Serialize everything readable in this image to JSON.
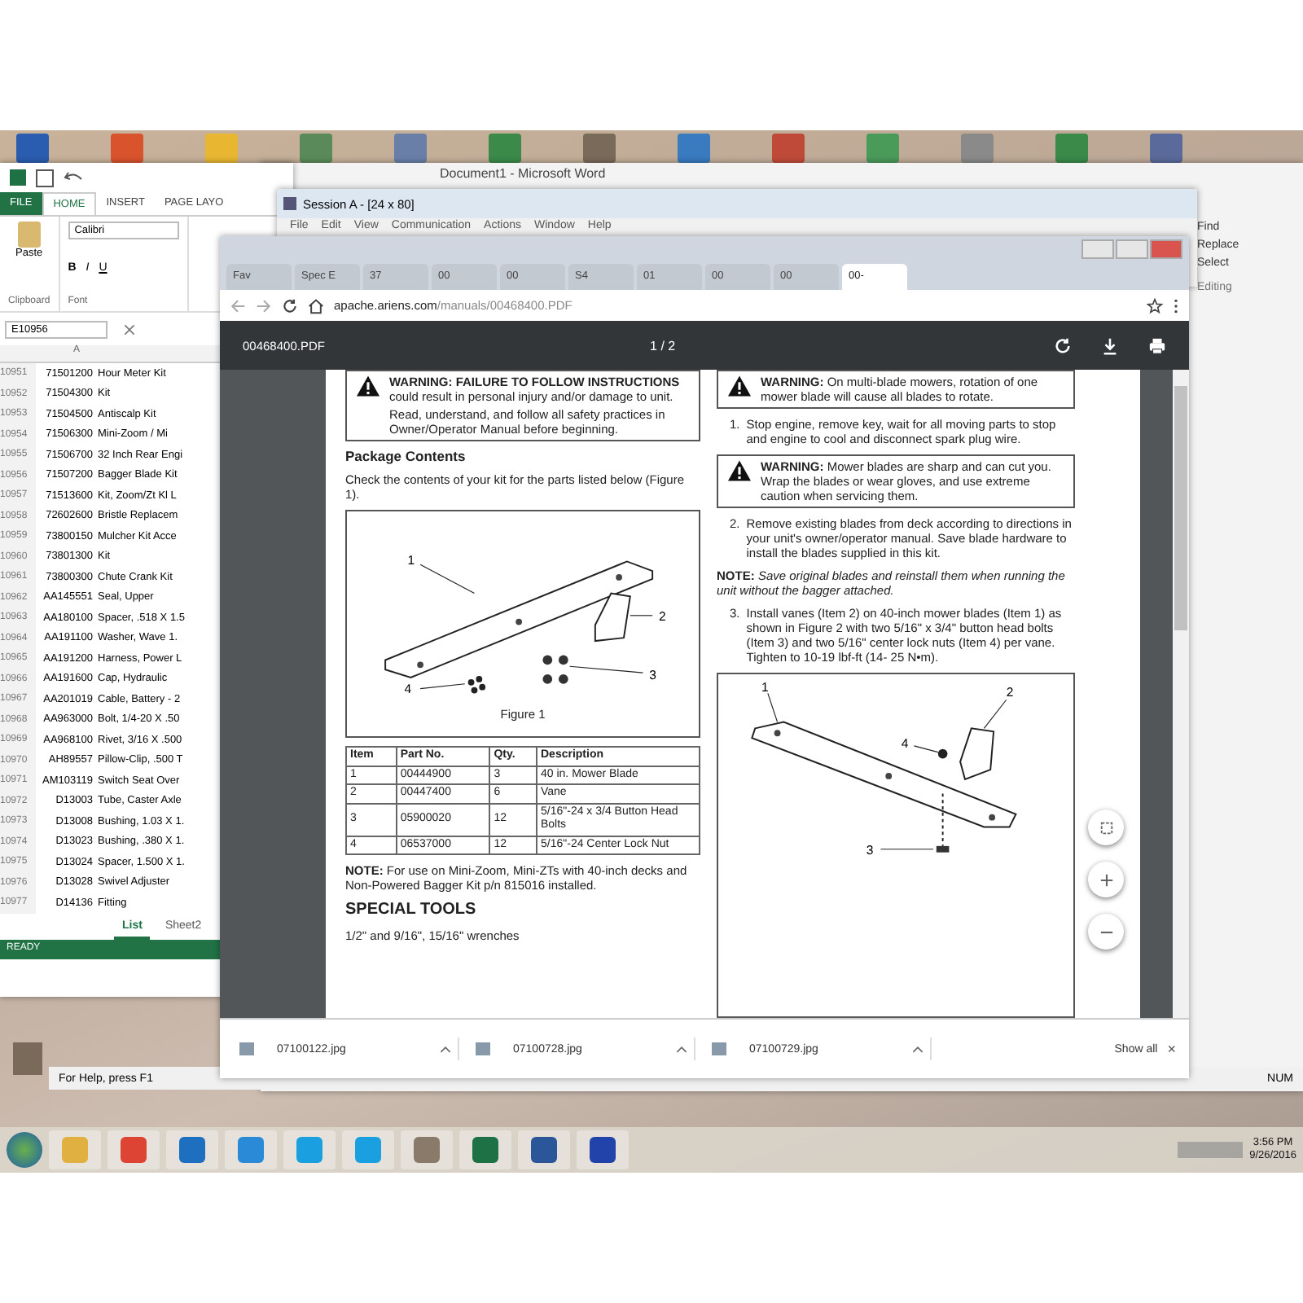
{
  "excel": {
    "ribbon_tabs": [
      {
        "label": "FILE",
        "selected": false
      },
      {
        "label": "HOME",
        "selected": true
      },
      {
        "label": "INSERT",
        "selected": false
      },
      {
        "label": "PAGE LAYO",
        "selected": false
      }
    ],
    "font_name": "Calibri",
    "paste_label": "Paste",
    "group_labels": [
      "Clipboard",
      "Font"
    ],
    "format_buttons": [
      "B",
      "I",
      "U"
    ],
    "name_box": "E10956",
    "column_header": "A",
    "rows": [
      {
        "num": "10951",
        "code": "71501200",
        "description": "Hour Meter Kit"
      },
      {
        "num": "10952",
        "code": "71504300",
        "description": "Kit"
      },
      {
        "num": "10953",
        "code": "71504500",
        "description": "Antiscalp Kit"
      },
      {
        "num": "10954",
        "code": "71506300",
        "description": "Mini-Zoom / Mi"
      },
      {
        "num": "10955",
        "code": "71506700",
        "description": "32 Inch Rear Engi"
      },
      {
        "num": "10956",
        "code": "71507200",
        "description": "Bagger Blade Kit"
      },
      {
        "num": "10957",
        "code": "71513600",
        "description": "Kit, Zoom/Zt Kl L"
      },
      {
        "num": "10958",
        "code": "72602600",
        "description": "Bristle Replacem"
      },
      {
        "num": "10959",
        "code": "73800150",
        "description": "Mulcher Kit Acce"
      },
      {
        "num": "10960",
        "code": "73801300",
        "description": "Kit"
      },
      {
        "num": "10961",
        "code": "73800300",
        "description": "Chute Crank Kit"
      },
      {
        "num": "10962",
        "code": "AA145551",
        "description": "Seal, Upper"
      },
      {
        "num": "10963",
        "code": "AA180100",
        "description": "Spacer, .518 X 1.5"
      },
      {
        "num": "10964",
        "code": "AA191100",
        "description": "Washer, Wave 1."
      },
      {
        "num": "10965",
        "code": "AA191200",
        "description": "Harness, Power L"
      },
      {
        "num": "10966",
        "code": "AA191600",
        "description": "Cap, Hydraulic"
      },
      {
        "num": "10967",
        "code": "AA201019",
        "description": "Cable, Battery - 2"
      },
      {
        "num": "10968",
        "code": "AA963000",
        "description": "Bolt, 1/4-20 X .50"
      },
      {
        "num": "10969",
        "code": "AA968100",
        "description": "Rivet, 3/16 X .500"
      },
      {
        "num": "10970",
        "code": "AH89557",
        "description": "Pillow-Clip, .500 T"
      },
      {
        "num": "10971",
        "code": "AM103119",
        "description": "Switch Seat Over"
      },
      {
        "num": "10972",
        "code": "D13003",
        "description": "Tube, Caster Axle"
      },
      {
        "num": "10973",
        "code": "D13008",
        "description": "Bushing, 1.03 X 1."
      },
      {
        "num": "10974",
        "code": "D13023",
        "description": "Bushing, .380 X 1."
      },
      {
        "num": "10975",
        "code": "D13024",
        "description": "Spacer, 1.500 X 1."
      },
      {
        "num": "10976",
        "code": "D13028",
        "description": "Swivel Adjuster"
      },
      {
        "num": "10977",
        "code": "D14136",
        "description": "Fitting"
      }
    ],
    "sheet_tabs": [
      {
        "label": "List",
        "selected": true
      },
      {
        "label": "Sheet2",
        "selected": false
      }
    ],
    "status": "READY"
  },
  "word": {
    "title": "Document1 - Microsoft Word",
    "editing_items": [
      "Find",
      "Replace",
      "Select"
    ],
    "group_label": "Editing"
  },
  "session": {
    "title": "Session A - [24 x 80]",
    "menu": [
      "File",
      "Edit",
      "View",
      "Communication",
      "Actions",
      "Window",
      "Help"
    ],
    "status": "For Help, press F1",
    "indicator": "NUM"
  },
  "browser": {
    "tabs": [
      {
        "label": "Fav",
        "selected": false
      },
      {
        "label": "Spec E",
        "selected": false
      },
      {
        "label": "37",
        "selected": false
      },
      {
        "label": "00",
        "selected": false
      },
      {
        "label": "00",
        "selected": false
      },
      {
        "label": "S4",
        "selected": false
      },
      {
        "label": "01",
        "selected": false
      },
      {
        "label": "00",
        "selected": false
      },
      {
        "label": "00",
        "selected": false
      },
      {
        "label": "00-",
        "selected": true
      }
    ],
    "address": {
      "host": "apache.ariens.com",
      "path": "/manuals/00468400.PDF"
    },
    "pdf": {
      "filename": "00468400.PDF",
      "page": "1",
      "separator": "/",
      "pages": "2",
      "columns": [
        [
          {
            "kind": "warning",
            "paragraphs": [
              "**WARNING: FAILURE TO FOLLOW INSTRUCTIONS** could result in personal injury and/or damage to unit.",
              "Read, understand, and follow all safety practices in Owner/Operator Manual before beginning."
            ]
          },
          {
            "kind": "heading",
            "text": "Package Contents"
          },
          {
            "kind": "paragraph",
            "text": "Check the contents of your kit for the parts listed below (Figure 1)."
          },
          {
            "kind": "figure",
            "caption": "Figure 1",
            "callouts": [
              "1",
              "2",
              "3",
              "4"
            ]
          },
          {
            "kind": "table",
            "columns": [
              "Item",
              "Part No.",
              "Qty.",
              "Description"
            ],
            "rows": [
              [
                "1",
                "00444900",
                "3",
                "40 in. Mower Blade"
              ],
              [
                "2",
                "00447400",
                "6",
                "Vane"
              ],
              [
                "3",
                "05900020",
                "12",
                "5/16\"-24 x 3/4 Button Head Bolts"
              ],
              [
                "4",
                "06537000",
                "12",
                "5/16\"-24 Center Lock Nut"
              ]
            ]
          },
          {
            "kind": "paragraph",
            "text": "**NOTE:** For use on Mini-Zoom, Mini-ZTs with 40-inch decks and Non-Powered Bagger Kit p/n 815016 installed."
          },
          {
            "kind": "title",
            "text": "SPECIAL TOOLS"
          },
          {
            "kind": "paragraph",
            "text": "1/2\" and 9/16\", 15/16\" wrenches"
          }
        ],
        [
          {
            "kind": "warning",
            "paragraphs": [
              "**WARNING:** On multi-blade mowers, rotation of one mower blade will cause all blades to rotate."
            ]
          },
          {
            "kind": "step",
            "number": "1.",
            "text": "Stop engine, remove key, wait for all moving parts to stop and engine to cool and disconnect spark plug wire."
          },
          {
            "kind": "warning",
            "paragraphs": [
              "**WARNING:** Mower blades are sharp and can cut you. Wrap the blades or wear gloves, and use extreme caution when servicing them."
            ]
          },
          {
            "kind": "step",
            "number": "2.",
            "text": "Remove existing blades from deck according to directions in your unit's owner/operator manual. Save blade hardware to install the blades supplied in this kit."
          },
          {
            "kind": "paragraph",
            "text": "**NOTE:** *Save original blades and reinstall them when running the unit without the bagger attached.*"
          },
          {
            "kind": "step",
            "number": "3.",
            "text": "Install vanes (Item 2) on 40-inch mower blades (Item 1) as shown in Figure 2 with two 5/16\" x 3/4\" button head bolts (Item 3) and two 5/16\" center lock nuts (Item 4) per vane. Tighten to 10-19 lbf-ft (14- 25 N•m)."
          },
          {
            "kind": "figure",
            "callouts": [
              "1",
              "2",
              "3",
              "4"
            ]
          }
        ]
      ]
    },
    "downloads": [
      {
        "file": "07100122.jpg"
      },
      {
        "file": "07100728.jpg"
      },
      {
        "file": "07100729.jpg"
      }
    ],
    "show_all": "Show all",
    "close": "×"
  },
  "taskbar": {
    "time": "3:56 PM",
    "date": "9/26/2016"
  }
}
